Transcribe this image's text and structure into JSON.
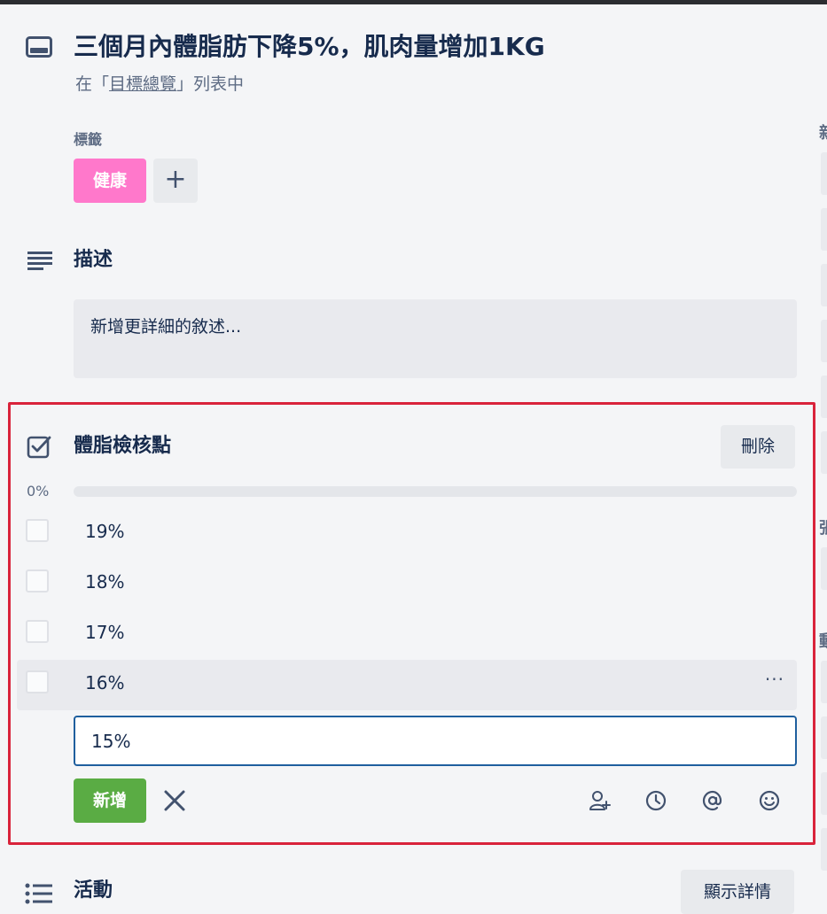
{
  "card": {
    "title": "三個月內體脂肪下降5%，肌肉量增加1KG",
    "in_list_prefix": "在「",
    "list_name": "目標總覽",
    "in_list_suffix": "」列表中"
  },
  "labels": {
    "heading": "標籤",
    "items": [
      {
        "name": "健康",
        "color": "#ff78cb"
      }
    ],
    "add_symbol": "+"
  },
  "description": {
    "heading": "描述",
    "placeholder": "新增更詳細的敘述..."
  },
  "checklist": {
    "title": "體脂檢核點",
    "delete_label": "刪除",
    "progress_text": "0%",
    "progress_fraction": 0,
    "items": [
      {
        "text": "19%",
        "checked": false
      },
      {
        "text": "18%",
        "checked": false
      },
      {
        "text": "17%",
        "checked": false
      },
      {
        "text": "16%",
        "checked": false
      }
    ],
    "more_symbol": "···",
    "new_item_value": "15%",
    "add_label": "新增",
    "highlight_color": "#d9233b"
  },
  "activity": {
    "heading": "活動",
    "details_label": "顯示詳情"
  },
  "sidebar": {
    "chars": [
      "新",
      "張",
      "動"
    ]
  }
}
